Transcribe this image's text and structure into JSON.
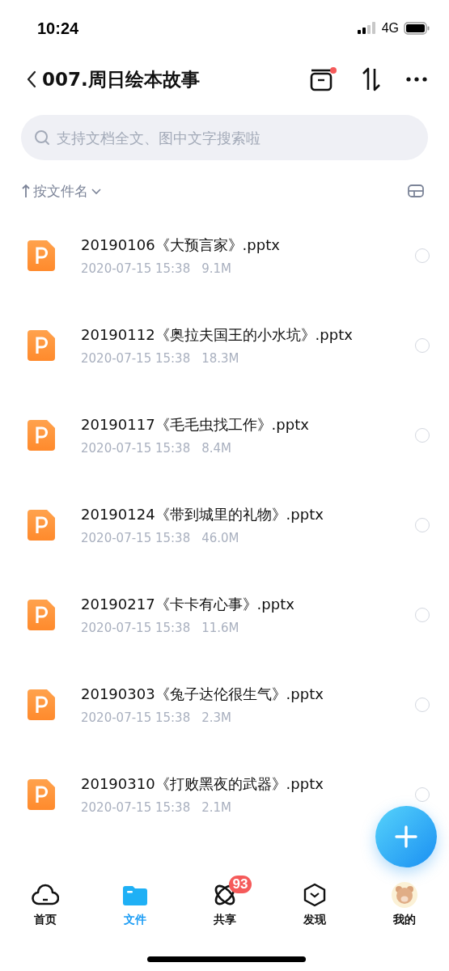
{
  "status_bar": {
    "time": "10:24",
    "network": "4G"
  },
  "header": {
    "title": "007.周日绘本故事",
    "has_notice": true
  },
  "search": {
    "placeholder": "支持文档全文、图中文字搜索啦"
  },
  "sort": {
    "label": "按文件名"
  },
  "files": [
    {
      "name": "20190106《大预言家》.pptx",
      "date": "2020-07-15 15:38",
      "size": "9.1M",
      "selected": false
    },
    {
      "name": "20190112《奥拉夫国王的小水坑》.pptx",
      "date": "2020-07-15 15:38",
      "size": "18.3M",
      "selected": false
    },
    {
      "name": "20190117《毛毛虫找工作》.pptx",
      "date": "2020-07-15 15:38",
      "size": "8.4M",
      "selected": false
    },
    {
      "name": "20190124《带到城里的礼物》.pptx",
      "date": "2020-07-15 15:38",
      "size": "46.0M",
      "selected": false
    },
    {
      "name": "20190217《卡卡有心事》.pptx",
      "date": "2020-07-15 15:38",
      "size": "11.6M",
      "selected": false
    },
    {
      "name": "20190303《兔子达伦很生气》.pptx",
      "date": "2020-07-15 15:38",
      "size": "2.3M",
      "selected": false
    },
    {
      "name": "20190310《打败黑夜的武器》.pptx",
      "date": "2020-07-15 15:38",
      "size": "2.1M",
      "selected": false
    }
  ],
  "tabs": [
    {
      "kind": "home",
      "label": "首页",
      "selected": false
    },
    {
      "kind": "files",
      "label": "文件",
      "selected": true
    },
    {
      "kind": "share",
      "label": "共享",
      "selected": false,
      "badge": "93"
    },
    {
      "kind": "discover",
      "label": "发现",
      "selected": false
    },
    {
      "kind": "me",
      "label": "我的",
      "selected": false
    }
  ]
}
